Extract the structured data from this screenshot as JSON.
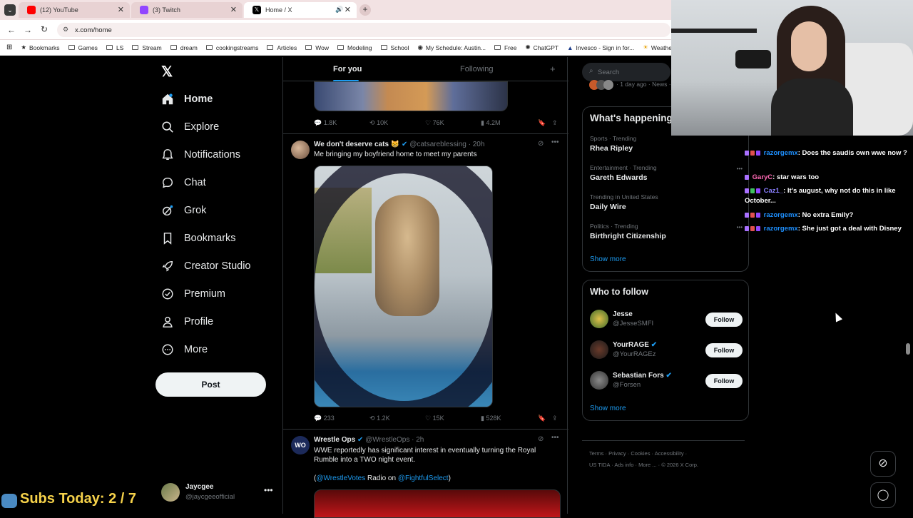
{
  "browser": {
    "tabs": [
      {
        "title": "(12) YouTube",
        "color": "#ff0000"
      },
      {
        "title": "(3) Twitch",
        "color": "#9146ff"
      },
      {
        "title": "Home / X",
        "color": "#000000"
      }
    ],
    "url": "x.com/home",
    "bookmarks": [
      "Bookmarks",
      "Games",
      "LS",
      "Stream",
      "dream",
      "cookingstreams",
      "Articles",
      "Wow",
      "Modeling",
      "School",
      "My Schedule: Austin...",
      "Free",
      "ChatGPT",
      "Invesco - Sign in for...",
      "Weathe"
    ]
  },
  "nav": {
    "items": [
      "Home",
      "Explore",
      "Notifications",
      "Chat",
      "Grok",
      "Bookmarks",
      "Creator Studio",
      "Premium",
      "Profile",
      "More"
    ],
    "post_label": "Post",
    "account_name": "Jaycgee",
    "account_handle": "@jaycgeeofficial"
  },
  "feed": {
    "tab_for_you": "For you",
    "tab_following": "Following",
    "tweet0_stats": {
      "replies": "1.8K",
      "reposts": "10K",
      "likes": "76K",
      "views": "4.2M"
    },
    "tweet1": {
      "name": "We don't deserve cats",
      "emoji": "😸",
      "handle": "@catsareblessing",
      "time": "· 20h",
      "text": "Me bringing my boyfriend home to meet my parents",
      "stats": {
        "replies": "233",
        "reposts": "1.2K",
        "likes": "15K",
        "views": "528K"
      }
    },
    "tweet2": {
      "name": "Wrestle Ops",
      "avatar_text": "WO",
      "handle": "@WrestleOps",
      "time": "· 2h",
      "text": "WWE reportedly has significant interest in eventually turning the Royal Rumble into a TWO night event.",
      "open_paren": "(",
      "mention1": "@WrestleVotes",
      "mid": " Radio on ",
      "mention2": "@FightfulSelect",
      "close_paren": ")"
    }
  },
  "sidebar": {
    "search_placeholder": "Search",
    "top_meta": "· 1 day ago · News ·",
    "happening_title": "What's happening",
    "trends": [
      {
        "meta": "Sports · Trending",
        "name": "Rhea Ripley"
      },
      {
        "meta": "Entertainment · Trending",
        "name": "Gareth Edwards"
      },
      {
        "meta": "Trending in United States",
        "name": "Daily Wire"
      },
      {
        "meta": "Politics · Trending",
        "name": "Birthright Citizenship"
      }
    ],
    "show_more": "Show more",
    "follow_title": "Who to follow",
    "follow": [
      {
        "name": "Jesse",
        "handle": "@JesseSMFI"
      },
      {
        "name": "YourRAGE",
        "handle": "@YourRAGEz"
      },
      {
        "name": "Sebastian Fors",
        "handle": "@Forsen"
      }
    ],
    "follow_label": "Follow",
    "footer_line1": [
      "Terms",
      "Privacy",
      "Cookies",
      "Accessibility"
    ],
    "footer_line2": [
      "US TIDA",
      "Ads info",
      "More ...",
      "© 2026 X Corp."
    ]
  },
  "chat": [
    {
      "user": "razorgemx",
      "user_color": "#1e90ff",
      "msg": ": Does the saudis own wwe now ?"
    },
    {
      "user": "GaryC",
      "user_color": "#ff69b4",
      "msg": ": star wars too"
    },
    {
      "user": "Caz1_",
      "user_color": "#8a7fff",
      "msg": ": It's august, why not do this in like October..."
    },
    {
      "user": "razorgemx",
      "user_color": "#1e90ff",
      "msg": ": No extra Emily?"
    },
    {
      "user": "razorgemx",
      "user_color": "#1e90ff",
      "msg": ": She just got a deal with Disney"
    }
  ],
  "overlay": {
    "subs_text": "Subs Today: 2 / 7"
  }
}
